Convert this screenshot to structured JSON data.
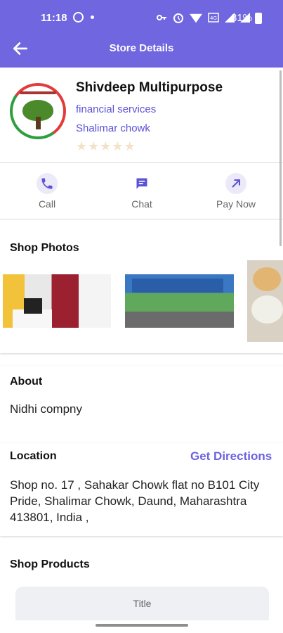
{
  "status_bar": {
    "time": "11:18",
    "icons": [
      "whatsapp-icon",
      "dot-icon",
      "key-icon",
      "alarm-icon",
      "wifi-icon",
      "volte-icon",
      "signal-icon",
      "signal-icon"
    ],
    "battery": "81%"
  },
  "header": {
    "title": "Store Details",
    "back_icon": "arrow-left-icon"
  },
  "store": {
    "name": "Shivdeep Multipurpose",
    "category": "financial services",
    "location": "Shalimar chowk",
    "rating_stars": 5,
    "rating_value": 0
  },
  "actions": [
    {
      "label": "Call",
      "icon": "phone-icon"
    },
    {
      "label": "Chat",
      "icon": "chat-icon"
    },
    {
      "label": "Pay Now",
      "icon": "arrow-up-right-icon"
    }
  ],
  "photos": {
    "heading": "Shop Photos",
    "items": [
      "office-photo",
      "storefront-photo",
      "food-photo"
    ]
  },
  "about": {
    "heading": "About",
    "text": "Nidhi compny"
  },
  "location": {
    "heading": "Location",
    "directions_label": "Get Directions",
    "address": "Shop no. 17 , Sahakar Chowk flat no B101 City Pride, Shalimar Chowk, Daund, Maharashtra 413801, India ,"
  },
  "products": {
    "heading": "Shop Products",
    "table_column": "Title"
  },
  "colors": {
    "primary": "#6f66e0",
    "link": "#5b53d6",
    "star_empty": "#f2e2c8"
  }
}
